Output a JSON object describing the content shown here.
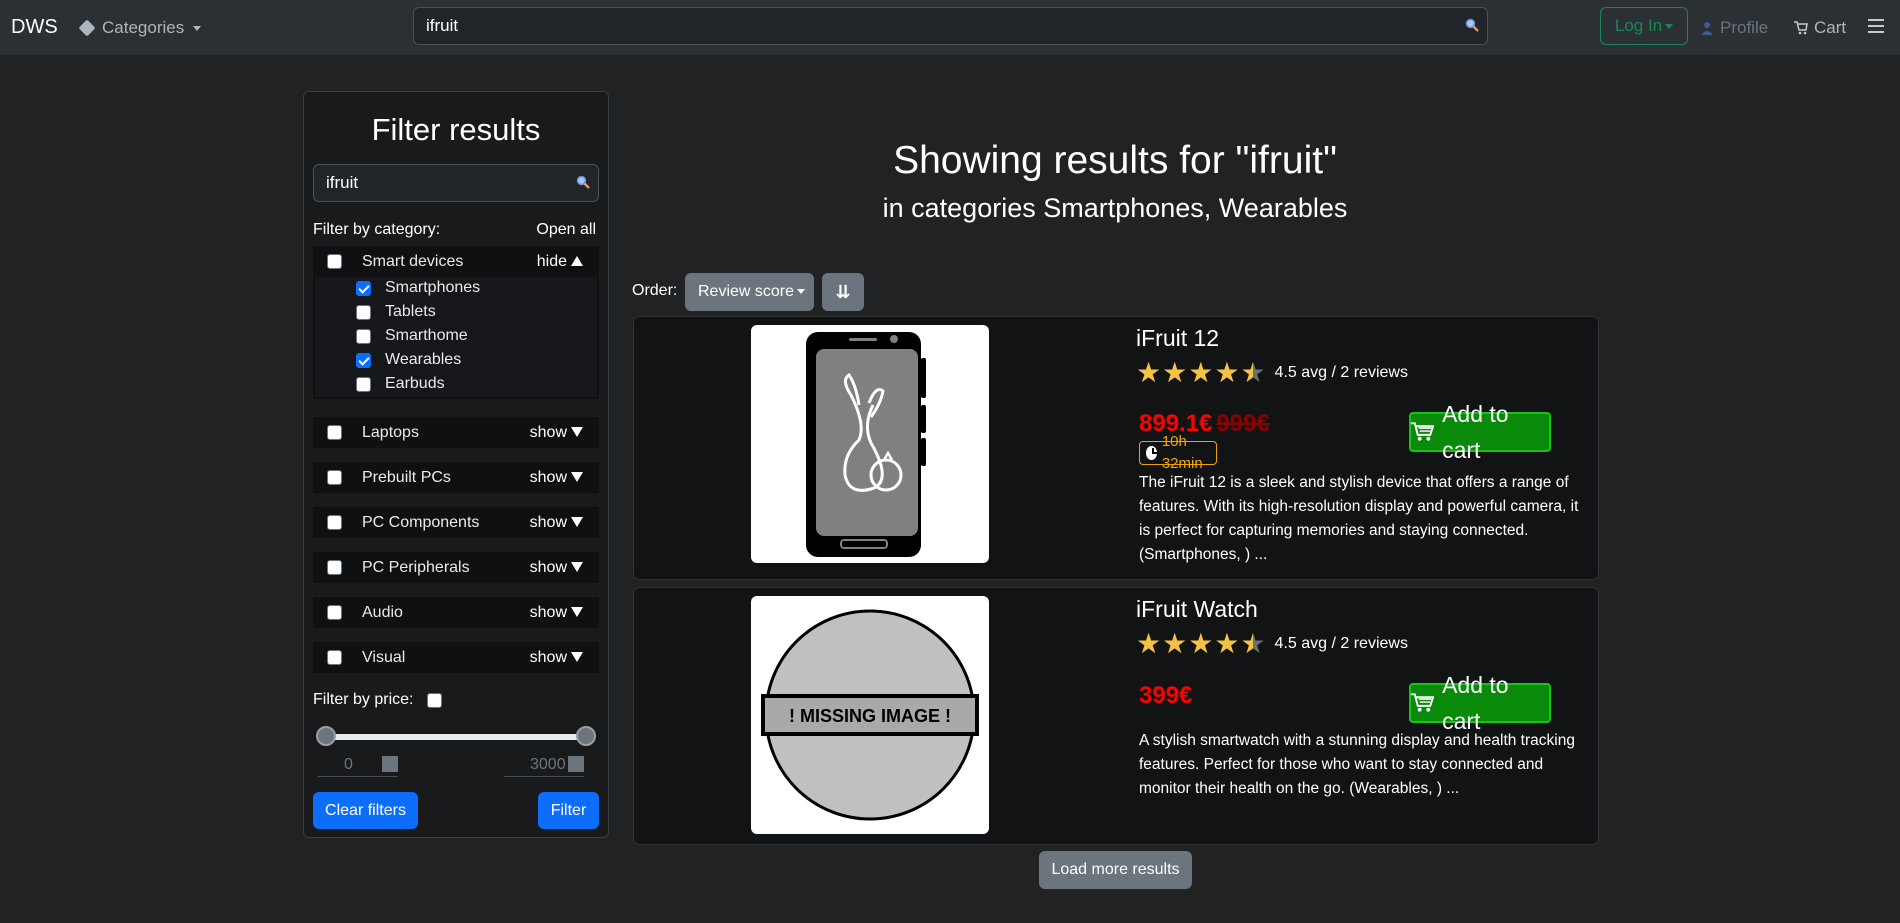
{
  "navbar": {
    "brand": "DWS",
    "categories_label": "Categories",
    "search_value": "ifruit",
    "login_label": "Log In",
    "profile_label": "Profile",
    "cart_label": "Cart"
  },
  "sidebar": {
    "title": "Filter results",
    "search_value": "ifruit",
    "filter_by_category": "Filter by category:",
    "open_all": "Open all",
    "categories": [
      {
        "label": "Smart devices",
        "toggle": "hide",
        "expanded": true
      },
      {
        "label": "Laptops",
        "toggle": "show"
      },
      {
        "label": "Prebuilt PCs",
        "toggle": "show"
      },
      {
        "label": "PC Components",
        "toggle": "show"
      },
      {
        "label": "PC Peripherals",
        "toggle": "show"
      },
      {
        "label": "Audio",
        "toggle": "show"
      },
      {
        "label": "Visual",
        "toggle": "show"
      }
    ],
    "subcategories": [
      {
        "label": "Smartphones",
        "checked": true
      },
      {
        "label": "Tablets",
        "checked": false
      },
      {
        "label": "Smarthome",
        "checked": false
      },
      {
        "label": "Wearables",
        "checked": true
      },
      {
        "label": "Earbuds",
        "checked": false
      }
    ],
    "filter_by_price": "Filter by price:",
    "price_min": "0",
    "price_max": "3000",
    "clear_label": "Clear filters",
    "filter_label": "Filter"
  },
  "main": {
    "heading": "Showing results for \"ifruit\"",
    "subheading": "in categories Smartphones, Wearables",
    "order_label": "Order:",
    "order_value": "Review score",
    "order_dir_icon": "⇊",
    "load_more": "Load more results"
  },
  "products": [
    {
      "title": "iFruit 12",
      "rating_text": "4.5 avg / 2 reviews",
      "rating": 4.5,
      "price": "899.1€",
      "old_price": "999€",
      "timer": "10h 32min",
      "add_label": "Add to cart",
      "description": "The iFruit 12 is a sleek and stylish device that offers a range of features. With its high-resolution display and powerful camera, it is perfect for capturing memories and staying connected. (Smartphones, ) ..."
    },
    {
      "title": "iFruit Watch",
      "rating_text": "4.5 avg / 2 reviews",
      "rating": 4.5,
      "price": "399€",
      "add_label": "Add to cart",
      "missing_image_text": "! MISSING IMAGE !",
      "description": "A stylish smartwatch with a stunning display and health tracking features. Perfect for those who want to stay connected and monitor their health on the go. (Wearables, ) ..."
    }
  ],
  "colors": {
    "page_bg": "#202224",
    "navbar_bg": "#2b3035",
    "price_red": "#ff0000",
    "add_green": "#0a8a0a",
    "star_yellow": "#f5c344",
    "primary_blue": "#0d6efd"
  },
  "icons": {
    "categories": "tag-icon",
    "search": "search-icon",
    "profile": "user-icon",
    "cart": "cart-icon",
    "menu": "hamburger-icon",
    "timer": "clock-icon"
  }
}
